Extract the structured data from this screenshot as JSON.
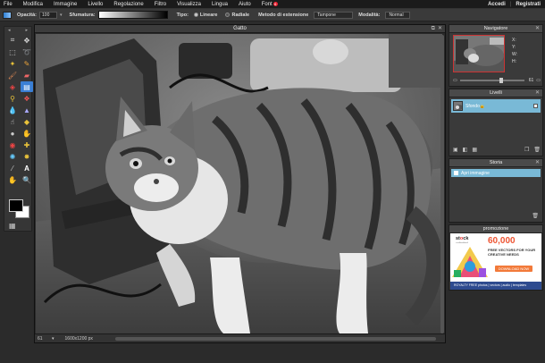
{
  "menu": {
    "items": [
      "File",
      "Modifica",
      "Immagine",
      "Livello",
      "Regolazione",
      "Filtro",
      "Visualizza",
      "Lingua",
      "Aiuto",
      "Font"
    ],
    "fonts_badge": "6",
    "login": "Accedi",
    "separator": "|",
    "register": "Registrati"
  },
  "options": {
    "opacity_label": "Opacità:",
    "opacity_value": "100",
    "gradient_label": "Sfumatura:",
    "type_label": "Tipo:",
    "type_linear": "Lineare",
    "type_radial": "Radiale",
    "extension_label": "Metodo di estensione",
    "extension_value": "Tampone",
    "mode_label": "Modalità:",
    "mode_value": "Normal"
  },
  "document": {
    "title": "Gatto",
    "zoom": "61",
    "dimensions": "1600x1200 px"
  },
  "navigator": {
    "title": "Navigatore",
    "x_label": "X:",
    "y_label": "Y:",
    "w_label": "W:",
    "h_label": "H:",
    "zoom_value": "61",
    "zoom_fraction": 0.61
  },
  "layers": {
    "title": "Livelli",
    "items": [
      {
        "name": "Sfondo"
      }
    ]
  },
  "history": {
    "title": "Storia",
    "items": [
      {
        "name": "Apri immagine"
      }
    ]
  },
  "promo": {
    "title": "promozione",
    "brand_a": "st",
    "brand_o": "o",
    "brand_b": "ck",
    "brand_sub": "unlimited",
    "headline": "60,000",
    "sub": "FREE VECTORS FOR YOUR CREATIVE NEEDS",
    "cta": "DOWNLOAD NOW",
    "footer": "ROYALTY FREE   photos  |  vectors  |  audio  |  templates"
  },
  "colors": {
    "accent": "#3a7fd5",
    "selection": "#79b9d6",
    "foreground": "#000000",
    "background": "#ffffff"
  }
}
